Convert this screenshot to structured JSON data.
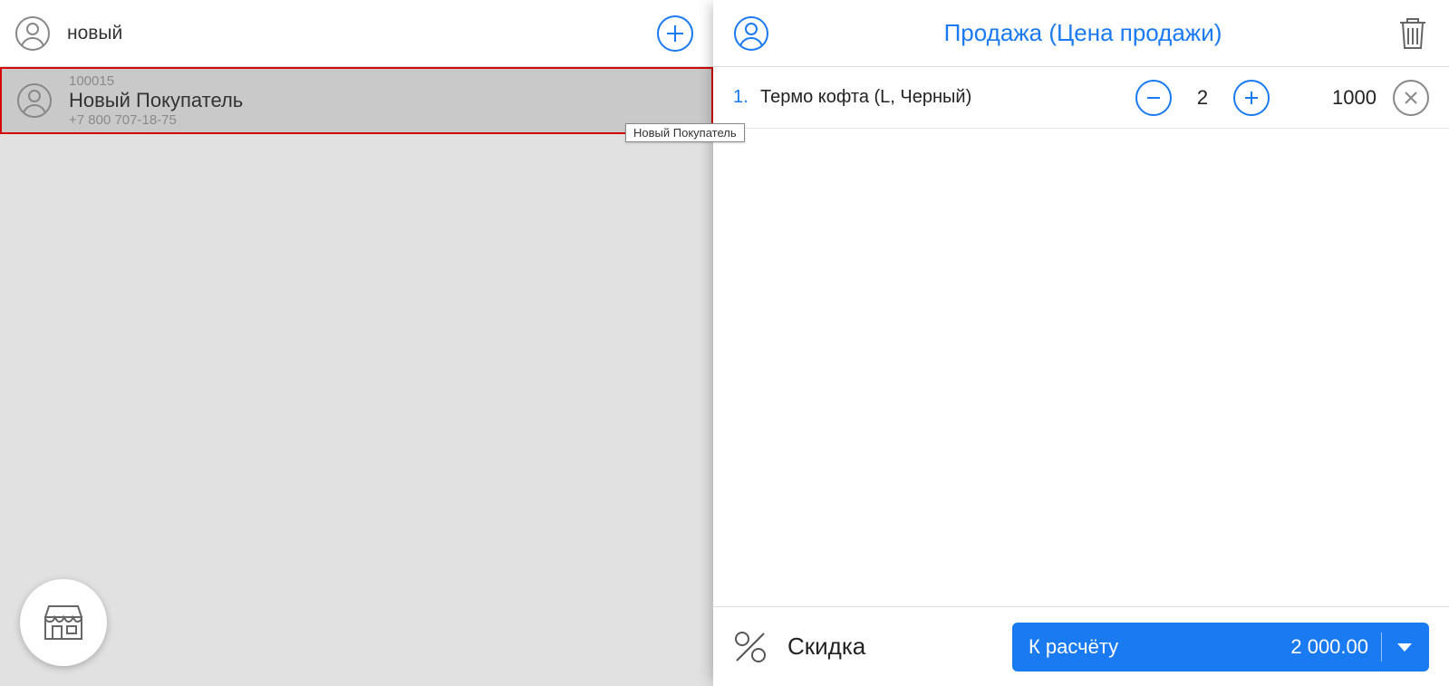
{
  "left": {
    "search_value": "новый",
    "results": [
      {
        "id": "100015",
        "name": "Новый Покупатель",
        "phone": "+7 800 707-18-75"
      }
    ],
    "tooltip": "Новый Покупатель"
  },
  "right": {
    "title": "Продажа (Цена продажи)",
    "items": [
      {
        "index": "1.",
        "name": "Термо кофта (L, Черный)",
        "qty": "2",
        "price": "1000"
      }
    ],
    "footer": {
      "discount_label": "Скидка",
      "checkout_label": "К расчёту",
      "checkout_amount": "2 000.00"
    }
  },
  "colors": {
    "accent": "#1a7af2"
  }
}
